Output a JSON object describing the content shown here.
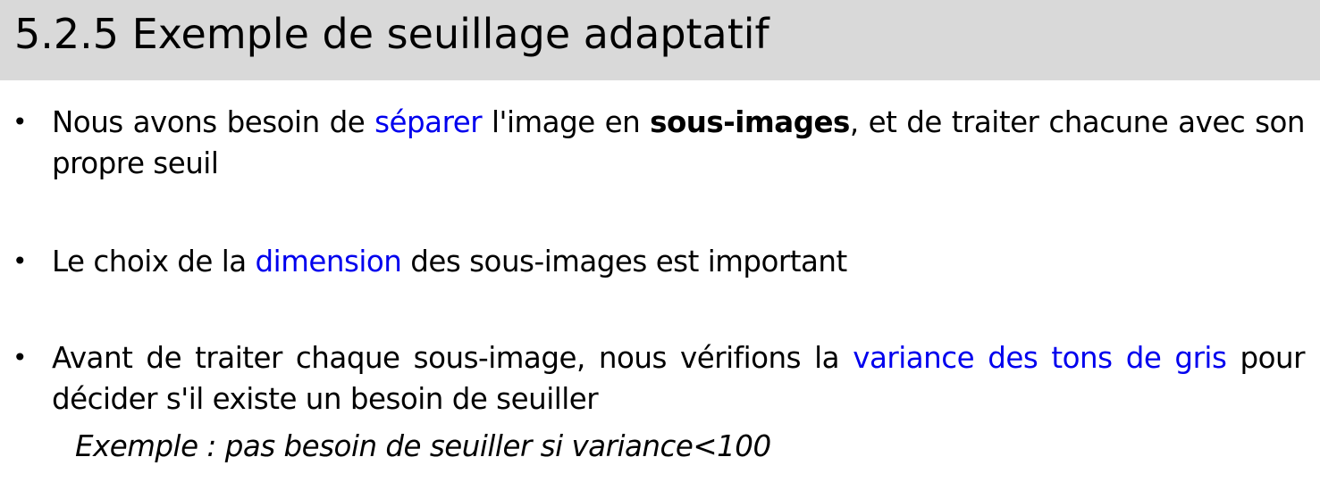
{
  "title": "5.2.5 Exemple de seuillage adaptatif",
  "bullet_symbol": "•",
  "bullets": [
    {
      "t1": "Nous avons besoin de ",
      "hl1": "séparer",
      "t2": " l'image en ",
      "bold1": "sous-images",
      "t3": ", et de traiter chacune avec son propre seuil"
    },
    {
      "t1": "Le choix de la ",
      "hl1": "dimension",
      "t2": " des sous-images est important"
    },
    {
      "t1": " Avant de traiter chaque sous-image, nous vérifions la ",
      "hl1": "variance des tons de gris",
      "t2": " pour décider s'il existe un besoin de seuiller"
    }
  ],
  "example": "Exemple : pas besoin de seuiller si variance<100",
  "colors": {
    "title_background": "#d9d9d9",
    "highlight": "#0000ee",
    "text": "#000000"
  }
}
